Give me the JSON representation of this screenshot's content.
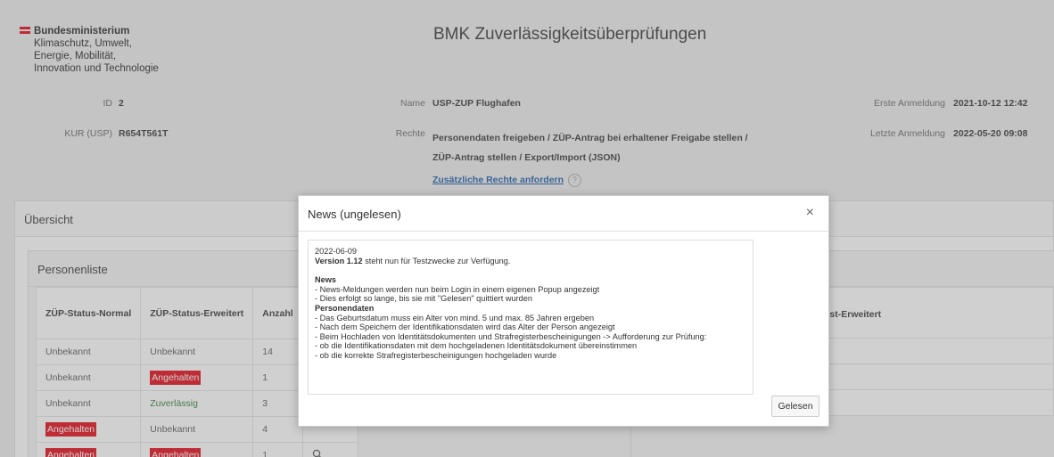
{
  "header": {
    "logo_line1": "Bundesministerium",
    "logo_line2": "Klimaschutz, Umwelt,",
    "logo_line3": "Energie, Mobilität,",
    "logo_line4": "Innovation und Technologie",
    "app_title": "BMK Zuverlässigkeitsüberprüfungen"
  },
  "info": {
    "id_label": "ID",
    "id_value": "2",
    "kur_label": "KUR (USP)",
    "kur_value": "R654T561T",
    "name_label": "Name",
    "name_value": "USP-ZUP Flughafen",
    "rechte_label": "Rechte",
    "rechte_line1": "Personendaten freigeben / ZÜP-Antrag bei erhaltener Freigabe stellen /",
    "rechte_line2": "ZÜP-Antrag stellen / Export/Import (JSON)",
    "link_text": "Zusätzliche Rechte anfordern",
    "help_icon": "?",
    "erste_label": "Erste Anmeldung",
    "erste_value": "2021-10-12 12:42",
    "letzte_label": "Letzte Anmeldung",
    "letzte_value": "2022-05-20 09:08"
  },
  "overview": {
    "title": "Übersicht"
  },
  "personenliste": {
    "title": "Personenliste",
    "columns": [
      "ZÜP-Status-Normal",
      "ZÜP-Status-Erweitert",
      "Anzahl"
    ],
    "rows": [
      {
        "normal": "Unbekannt",
        "erweitert": "Unbekannt",
        "anzahl": "14"
      },
      {
        "normal": "Unbekannt",
        "erweitert": "Angehalten",
        "anzahl": "1"
      },
      {
        "normal": "Unbekannt",
        "erweitert": "Zuverlässig",
        "anzahl": "3"
      },
      {
        "normal": "Angehalten",
        "erweitert": "Unbekannt",
        "anzahl": "4"
      },
      {
        "normal": "Angehalten",
        "erweitert": "Angehalten",
        "anzahl": "1"
      }
    ],
    "right_column_header": "Frist-Erweitert"
  },
  "modal": {
    "title": "News (ungelesen)",
    "close_icon": "×",
    "date": "2022-06-09",
    "version_bold": "Version 1.12",
    "version_rest": " steht nun für Testzwecke zur Verfügung.",
    "news_heading": "News",
    "news_items": [
      "- News-Meldungen werden nun beim Login in einem eigenen Popup angezeigt",
      "- Dies erfolgt so lange, bis sie mit \"Gelesen\" quittiert wurden"
    ],
    "personendaten_heading": "Personendaten",
    "personendaten_items": [
      "- Das Geburtsdatum muss ein Alter von mind. 5 und max. 85 Jahren ergeben",
      "- Nach dem Speichern der Identifikationsdaten wird das Alter der Person angezeigt",
      "- Beim Hochladen von Identitätsdokumenten und Strafregisterbescheinigungen -> Aufforderung zur Prüfung:",
      "- ob die Identifikationsdaten mit dem hochgeladenen Identitätsdokument übereinstimmen",
      "- ob die korrekte Strafregisterbescheinigungen hochgeladen wurde"
    ],
    "button_label": "Gelesen"
  },
  "colors": {
    "brand_red": "#e30613",
    "link_blue": "#1a5aa6",
    "green": "#2e7d32"
  }
}
